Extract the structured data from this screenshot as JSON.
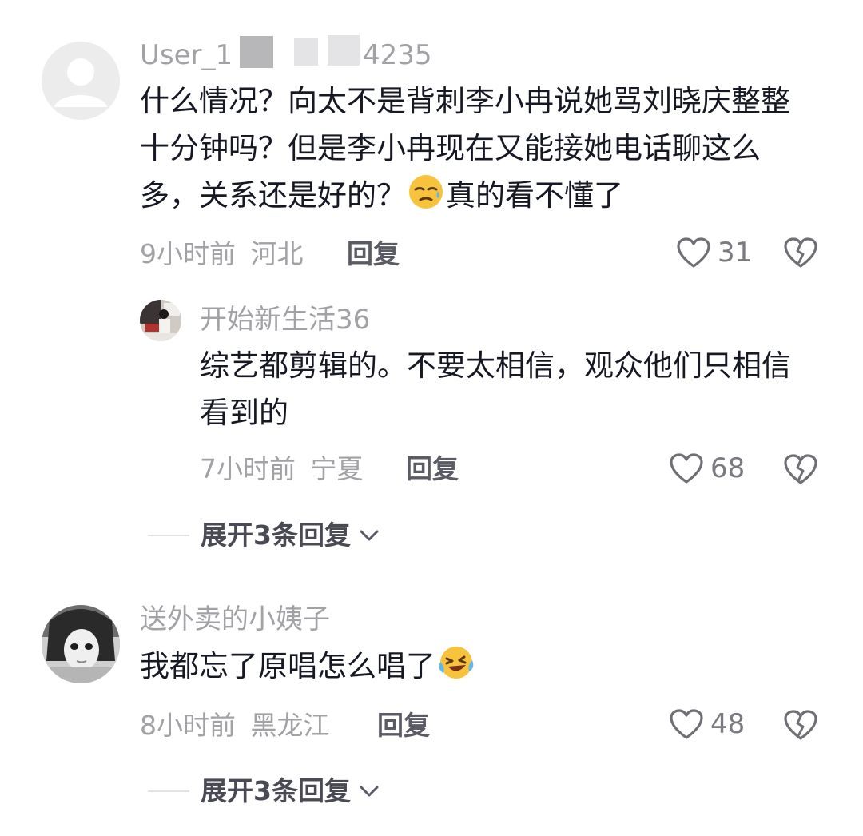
{
  "comments": [
    {
      "username": "User_1  ▆  ⠀⠀ 4235",
      "username_parts": {
        "prefix": "User_1",
        "suffix": "4235"
      },
      "content_parts": [
        "什么情况？向太不是背刺李小冉说她骂刘晓庆整整十分钟吗？但是李小冉现在又能接她电话聊这么多，关系还是好的？",
        "真的看不懂了"
      ],
      "emoji": "sweat-smile-emoji",
      "time": "9小时前",
      "region": "河北",
      "reply_label": "回复",
      "likes": "31",
      "replies": [
        {
          "username": "开始新生活36",
          "content": "综艺都剪辑的。不要太相信，观众他们只相信看到的",
          "time": "7小时前",
          "region": "宁夏",
          "reply_label": "回复",
          "likes": "68"
        }
      ],
      "expand_label": "展开3条回复"
    },
    {
      "username": "送外卖的小姨子",
      "content": "我都忘了原唱怎么唱了",
      "emoji": "laughing-crying-emoji",
      "time": "8小时前",
      "region": "黑龙江",
      "reply_label": "回复",
      "likes": "48",
      "expand_label": "展开3条回复"
    }
  ],
  "colors": {
    "text_primary": "#161823",
    "text_secondary": "#a2a2a6",
    "reply_text": "#5b5b66",
    "background": "#ffffff"
  },
  "icons": [
    "default-avatar-icon",
    "heart-icon",
    "broken-heart-icon",
    "chevron-down-icon"
  ]
}
